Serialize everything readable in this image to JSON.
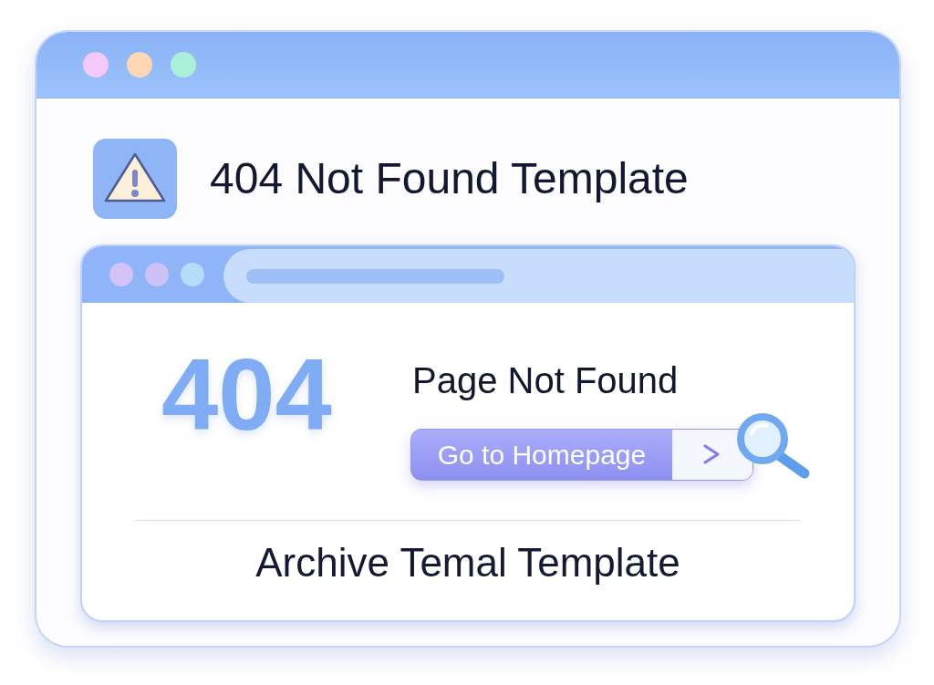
{
  "window": {
    "controls": [
      {
        "color": "#f4c9f9"
      },
      {
        "color": "#fdd6b2"
      },
      {
        "color": "#aaf0d8"
      }
    ]
  },
  "header": {
    "title": "404 Not Found Template"
  },
  "preview_window": {
    "controls": [
      {
        "color": "#d3c3f8"
      },
      {
        "color": "#cdc2f7"
      },
      {
        "color": "#b5dcfb"
      }
    ],
    "error_code": "404",
    "heading": "Page Not Found",
    "button": {
      "label": "Go to Homepage"
    },
    "footer": "Archive Temal Template"
  }
}
